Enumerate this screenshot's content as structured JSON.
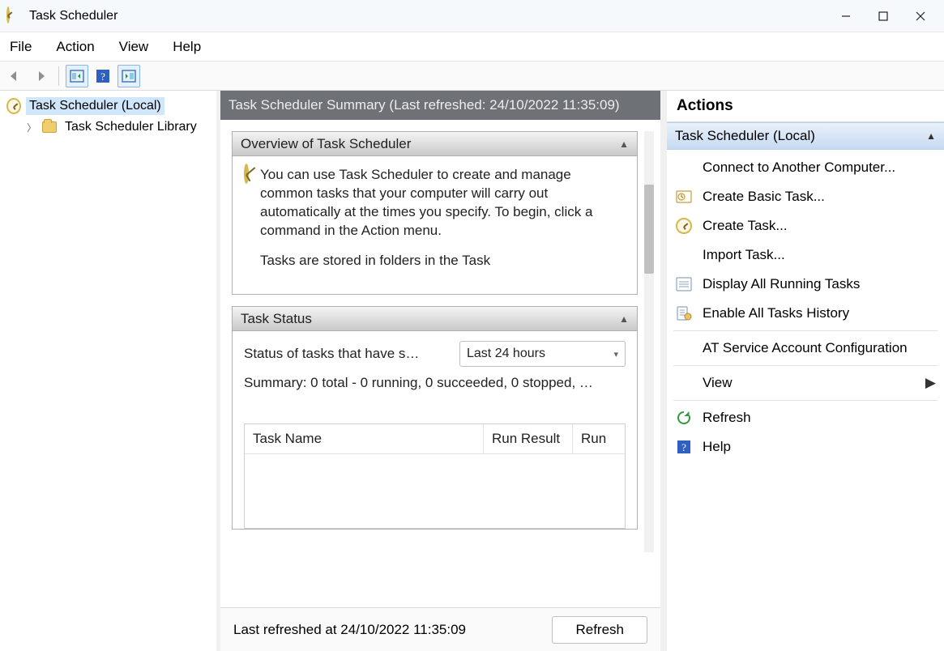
{
  "window": {
    "title": "Task Scheduler"
  },
  "menubar": [
    "File",
    "Action",
    "View",
    "Help"
  ],
  "tree": {
    "root": "Task Scheduler (Local)",
    "child": "Task Scheduler Library"
  },
  "center": {
    "summary_title": "Task Scheduler Summary (Last refreshed: 24/10/2022 11:35:09)",
    "overview_title": "Overview of Task Scheduler",
    "overview_text": "You can use Task Scheduler to create and manage common tasks that your computer will carry out automatically at the times you specify. To begin, click a command in the Action menu.",
    "overview_text_2": "Tasks are stored in folders in the Task",
    "task_status_title": "Task Status",
    "status_label": "Status of tasks that have s…",
    "status_dropdown": "Last 24 hours",
    "status_summary": "Summary: 0 total - 0 running, 0 succeeded, 0 stopped, …",
    "columns": [
      "Task Name",
      "Run Result",
      "Run"
    ],
    "footer": "Last refreshed at 24/10/2022 11:35:09",
    "refresh_btn": "Refresh"
  },
  "actions": {
    "title": "Actions",
    "section": "Task Scheduler (Local)",
    "items": [
      "Connect to Another Computer...",
      "Create Basic Task...",
      "Create Task...",
      "Import Task...",
      "Display All Running Tasks",
      "Enable All Tasks History",
      "AT Service Account Configuration",
      "View",
      "Refresh",
      "Help"
    ]
  }
}
